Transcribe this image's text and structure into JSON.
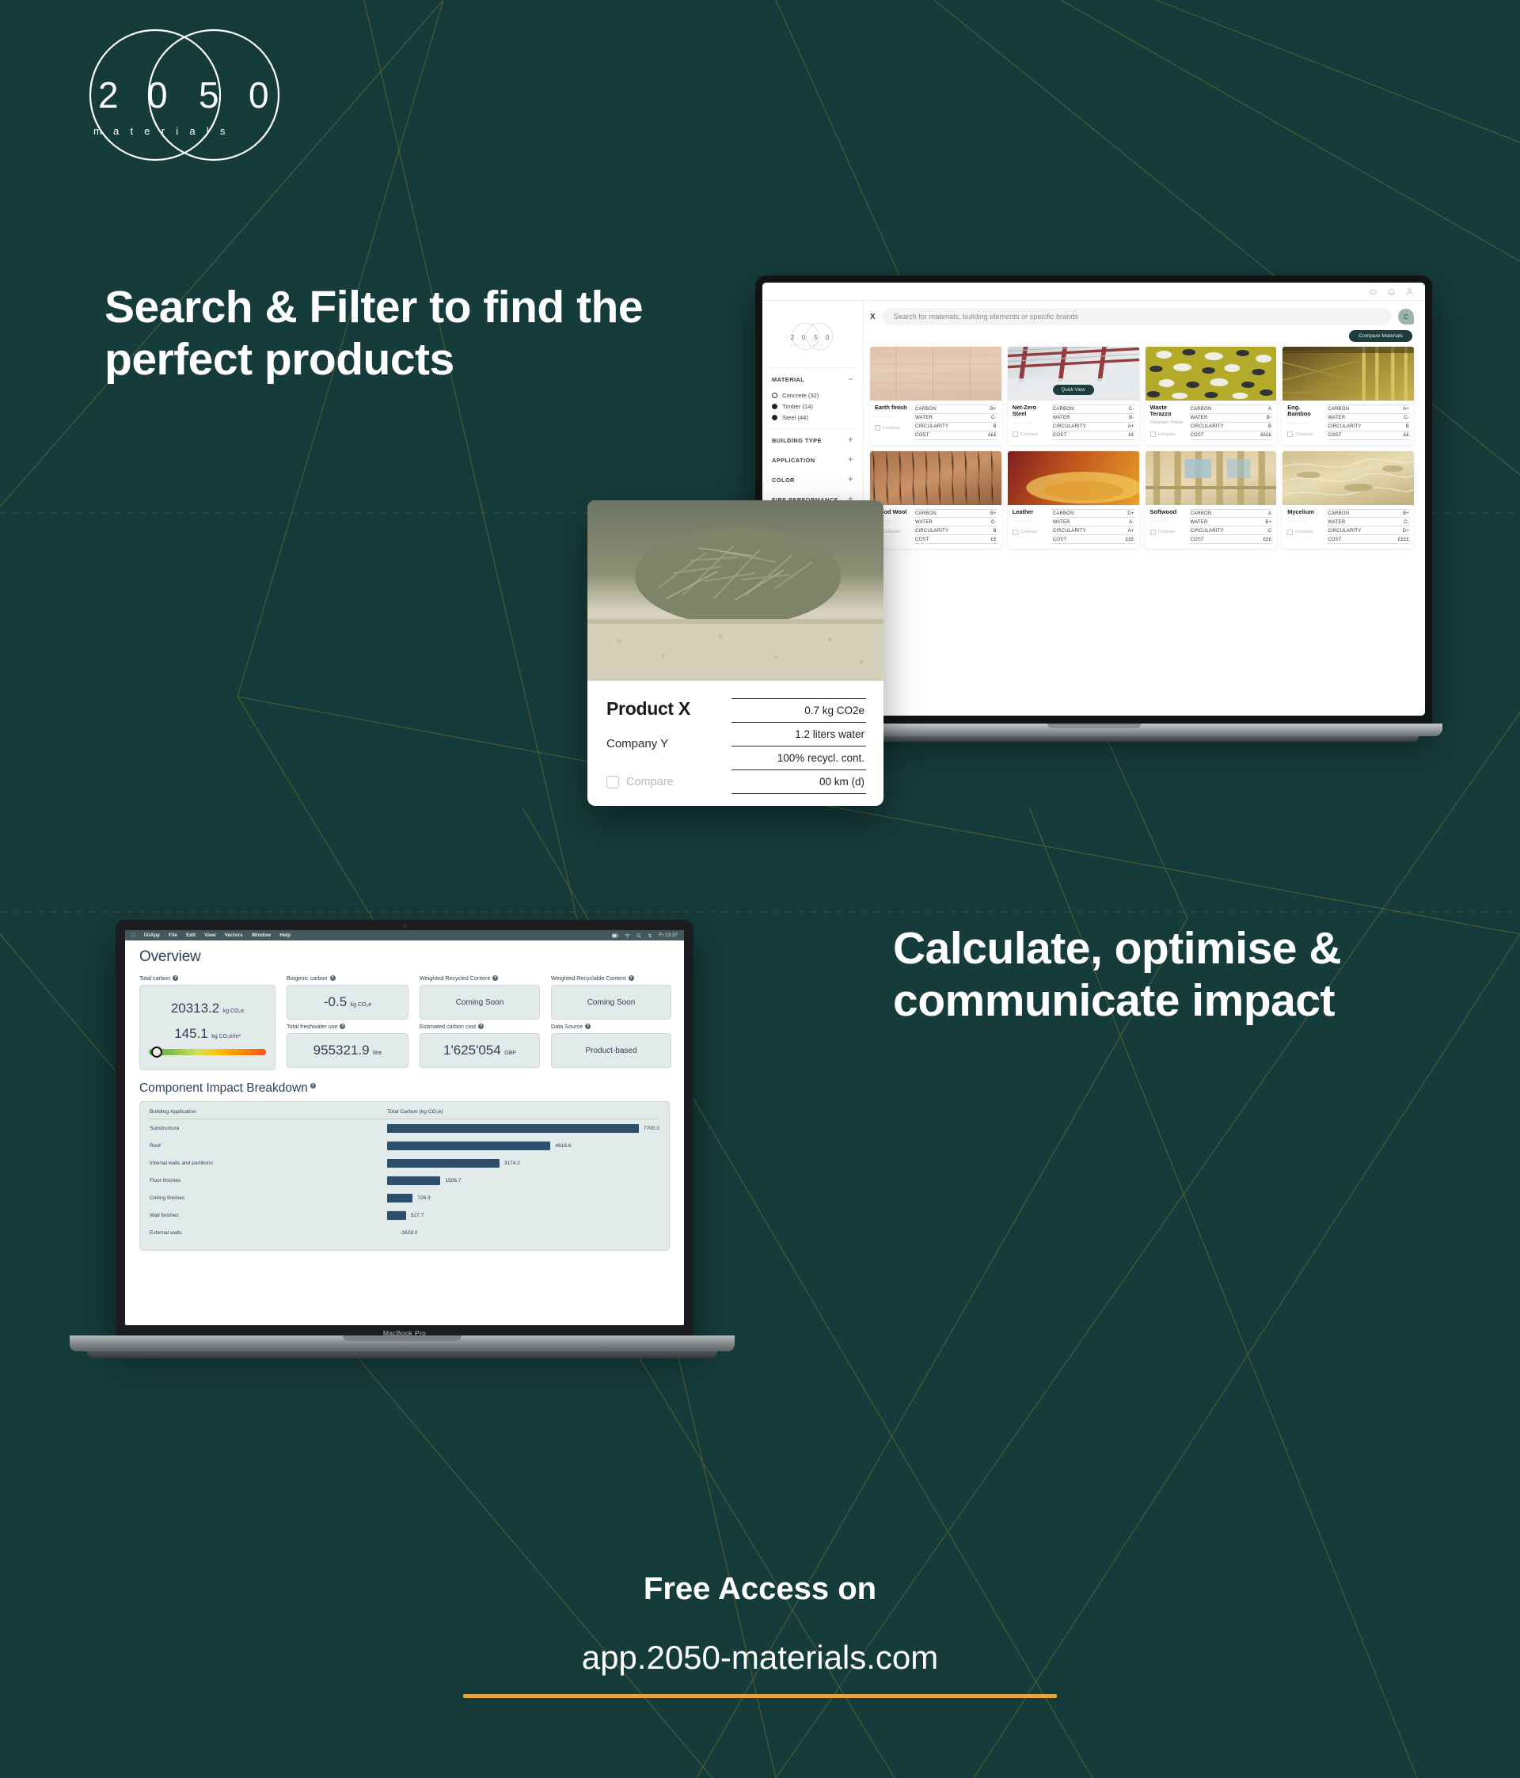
{
  "brand": {
    "logo_digits": [
      "2",
      "0",
      "5",
      "0"
    ],
    "logo_word": "m a t e r i a l s",
    "bg_color": "#163b3b",
    "accent_color": "#e8a33d",
    "dark_ui_color": "#1d3c3c"
  },
  "headlines": {
    "top": "Search & Filter to find the perfect products",
    "bottom": "Calculate, optimise & communicate impact"
  },
  "cta": {
    "line1": "Free Access on",
    "line2": "app.2050-materials.com"
  },
  "browser": {
    "icons": [
      "cloud-icon",
      "bell-icon",
      "user-icon"
    ],
    "close_label": "X",
    "search_placeholder": "Search for materials, building elements or specific brands",
    "avatar_initial": "C",
    "compare_button": "Compare Materials",
    "quick_view": "Quick View",
    "compare_checkbox_label": "Compare",
    "metric_labels": [
      "CARBON",
      "WATER",
      "CIRCULARITY",
      "COST"
    ],
    "sidebar": {
      "sections": [
        {
          "label": "MATERIAL",
          "sign": "–",
          "expanded": true
        },
        {
          "label": "BUILDING TYPE",
          "sign": "+",
          "expanded": false
        },
        {
          "label": "APPLICATION",
          "sign": "+",
          "expanded": false
        },
        {
          "label": "COLOR",
          "sign": "+",
          "expanded": false
        },
        {
          "label": "FIRE PERFORMANCE",
          "sign": "+",
          "expanded": false
        }
      ],
      "material_options": [
        {
          "label": "Concrete (32)",
          "selected": false
        },
        {
          "label": "Timber (14)",
          "selected": true
        },
        {
          "label": "Steel (44)",
          "selected": true
        }
      ]
    },
    "cards": [
      {
        "title": "Earth finish",
        "company": "...............",
        "img": "earth",
        "metrics": [
          "B+",
          "C-",
          "B",
          "£££"
        ]
      },
      {
        "title": "Net-Zero Steel",
        "company": "...............",
        "img": "steel",
        "quick_view": true,
        "metrics": [
          "C-",
          "B-",
          "A+",
          "££"
        ]
      },
      {
        "title": "Waste Terazzo",
        "company": "Vetraland Timber",
        "img": "terrazzo",
        "metrics": [
          "A",
          "B-",
          "B",
          "££££"
        ]
      },
      {
        "title": "Eng. Bamboo",
        "company": "...............",
        "img": "bamboo",
        "metrics": [
          "A+",
          "C-",
          "B",
          "££"
        ]
      },
      {
        "title": "Wood Wool",
        "company": "...............",
        "img": "woodwool",
        "metrics": [
          "B+",
          "C-",
          "B",
          "££"
        ]
      },
      {
        "title": "Leather",
        "company": "...............",
        "img": "leather",
        "metrics": [
          "D+",
          "A-",
          "A+",
          "£££"
        ]
      },
      {
        "title": "Softwood",
        "company": "...............",
        "img": "softwood",
        "metrics": [
          "A",
          "B+",
          "C",
          "£££"
        ]
      },
      {
        "title": "Mycelium",
        "company": "...............",
        "img": "mycelium",
        "metrics": [
          "B+",
          "C-",
          "D+",
          "££££"
        ]
      }
    ]
  },
  "product_card": {
    "title": "Product X",
    "company": "Company Y",
    "compare_label": "Compare",
    "stats": [
      "0.7 kg CO2e",
      "1.2 liters water",
      "100% recycl. cont.",
      "00 km (d)"
    ]
  },
  "laptop2": {
    "device_label": "MacBook Pro",
    "menubar": {
      "apple": "",
      "items": [
        "iXiApp",
        "File",
        "Edit",
        "View",
        "Vectors",
        "Window",
        "Help"
      ],
      "clock": "Fr 13:37"
    },
    "page_title": "Overview",
    "metrics": [
      {
        "label": "Total carbon",
        "value": "20313.2",
        "unit": "kg CO₂e",
        "value2": "145.1",
        "unit2": "kg CO₂e/m²",
        "gauge": true
      },
      {
        "label": "Biogenic carbon",
        "value": "-0.5",
        "unit": "kg CO₂e"
      },
      {
        "label": "Total freshwater use",
        "value": "955321.9",
        "unit": "litre"
      },
      {
        "label": "Weighted Recycled Content",
        "value": "Coming Soon",
        "unit": ""
      },
      {
        "label": "Estimated carbon cost",
        "value": "1'625'054",
        "unit": "GBP"
      },
      {
        "label": "Weighted Recyclable Content",
        "value": "Coming Soon",
        "unit": ""
      },
      {
        "label": "Data Source",
        "value": "Product-based",
        "unit": ""
      }
    ],
    "section_title": "Component Impact Breakdown"
  },
  "chart_data": {
    "type": "bar",
    "title": "Component Impact Breakdown",
    "orientation": "horizontal",
    "columns": [
      "Building Application",
      "Total Carbon (kg CO₂e)"
    ],
    "categories": [
      "Substructure",
      "Roof",
      "Internal walls and partitions",
      "Floor finishes",
      "Ceiling finishes",
      "Wall finishes",
      "External walls"
    ],
    "values": [
      7700.0,
      4616.6,
      3174.2,
      1506.7,
      726.9,
      527.7,
      -1628.0
    ],
    "value_labels": [
      "7700.0",
      "4616.6",
      "3174.2",
      "1506.7",
      "726.9",
      "527.7",
      "-1628.0"
    ],
    "xlabel": "Total Carbon (kg CO₂e)",
    "ylabel": "Building Application",
    "xlim": [
      0,
      7700
    ],
    "grid": false,
    "legend": "none",
    "bar_color": "#2d4f6b"
  }
}
